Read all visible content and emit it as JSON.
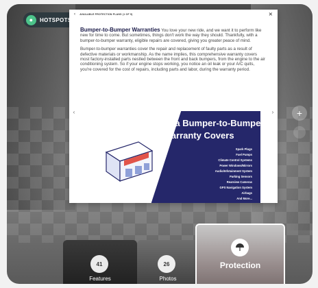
{
  "hotspots": {
    "label": "HOTSPOTS"
  },
  "modal": {
    "header_title": "AVAILABLE PROTECTION PLANS (1 OF 5)",
    "lead_title": "Bumper-to-Bumper Warranties",
    "lead_text": " You love your new ride, and we want it to perform like new for time to come. But sometimes, things don't work the way they should. Thankfully, with a bumper-to-bumper warranty, eligible repairs are covered, giving you greater peace of mind.",
    "paragraph2": "Bumper-to-bumper warranties cover the repair and replacement of faulty parts as a result of defective materials or workmanship. As the name implies, this comprehensive warranty covers most factory-installed parts nestled between the front and back bumpers, from the engine to the air conditioning system. So if your engine stops working, you notice an oil leak or your A/C quits, you're covered for the cost of repairs, including parts and labor, during the warranty period."
  },
  "infographic": {
    "title_line1": "What a Bumper-to-Bumper",
    "title_line2": "Warranty Covers",
    "items": [
      "Spark Plugs",
      "Fuel Pumps",
      "Climate Control Systems",
      "Power Windows/Mirrors",
      "Audio/Infotainment System",
      "Parking Sensors",
      "Rearview Cameras",
      "GPS Navigation System",
      "Airbags",
      "And More..."
    ]
  },
  "thumbs": {
    "features": {
      "count": "41",
      "label": "Features"
    },
    "photos": {
      "count": "26",
      "label": "Photos"
    },
    "protection": {
      "label": "Protection"
    }
  },
  "colors": {
    "brand_navy": "#25276a",
    "hotspot_green": "#4cc38a"
  }
}
